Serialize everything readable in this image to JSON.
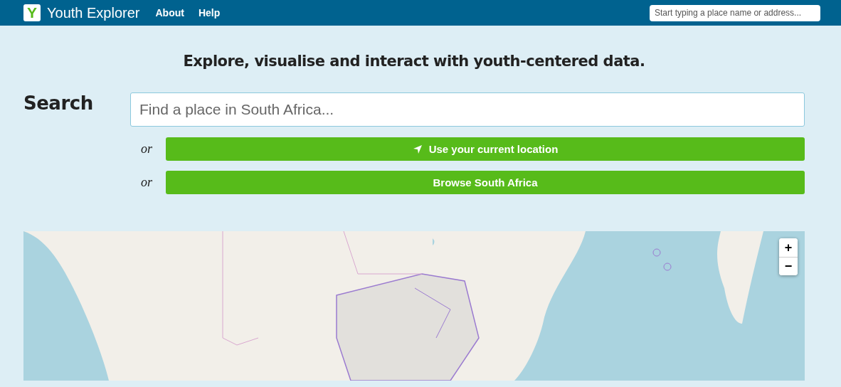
{
  "navbar": {
    "logo_letter": "Y",
    "brand": "Youth Explorer",
    "links": [
      "About",
      "Help"
    ],
    "search": {
      "placeholder": "Start typing a place name or address..."
    }
  },
  "tagline": "Explore, visualise and interact with youth-centered data.",
  "search": {
    "heading": "Search",
    "field": {
      "placeholder": "Find a place in South Africa..."
    },
    "options": [
      {
        "kind": "location",
        "or": "or",
        "label": "Use your current location"
      },
      {
        "kind": "browse",
        "or": "or",
        "label": "Browse South Africa"
      }
    ]
  },
  "map": {
    "kind": "picture",
    "zoom_controls": [
      "+",
      "−"
    ]
  }
}
